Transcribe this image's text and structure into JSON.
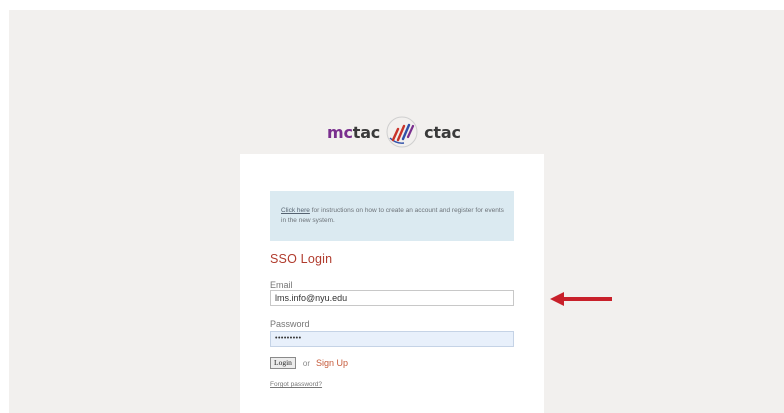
{
  "logo": {
    "part1": "mc",
    "part2": "tac",
    "part3": "ctac",
    "mark_icon": "mctac-ctac-slash-mark-icon",
    "colors": {
      "purple": "#7a2f8e",
      "dark": "#3a3a3a",
      "red": "#c8332a",
      "blue": "#2f4fa8"
    }
  },
  "info": {
    "link_text": "Click here",
    "text": " for instructions on how to create an account and register for events in the new system."
  },
  "login": {
    "title": "SSO Login",
    "email_label": "Email",
    "email_value": "lms.info@nyu.edu",
    "password_label": "Password",
    "password_value": "•••••••••",
    "login_button": "Login",
    "or_text": "or",
    "signup_link": "Sign Up",
    "forgot_link": "Forgot password?"
  },
  "annotation": {
    "arrow_icon": "left-arrow-icon",
    "arrow_color": "#c8202a"
  }
}
